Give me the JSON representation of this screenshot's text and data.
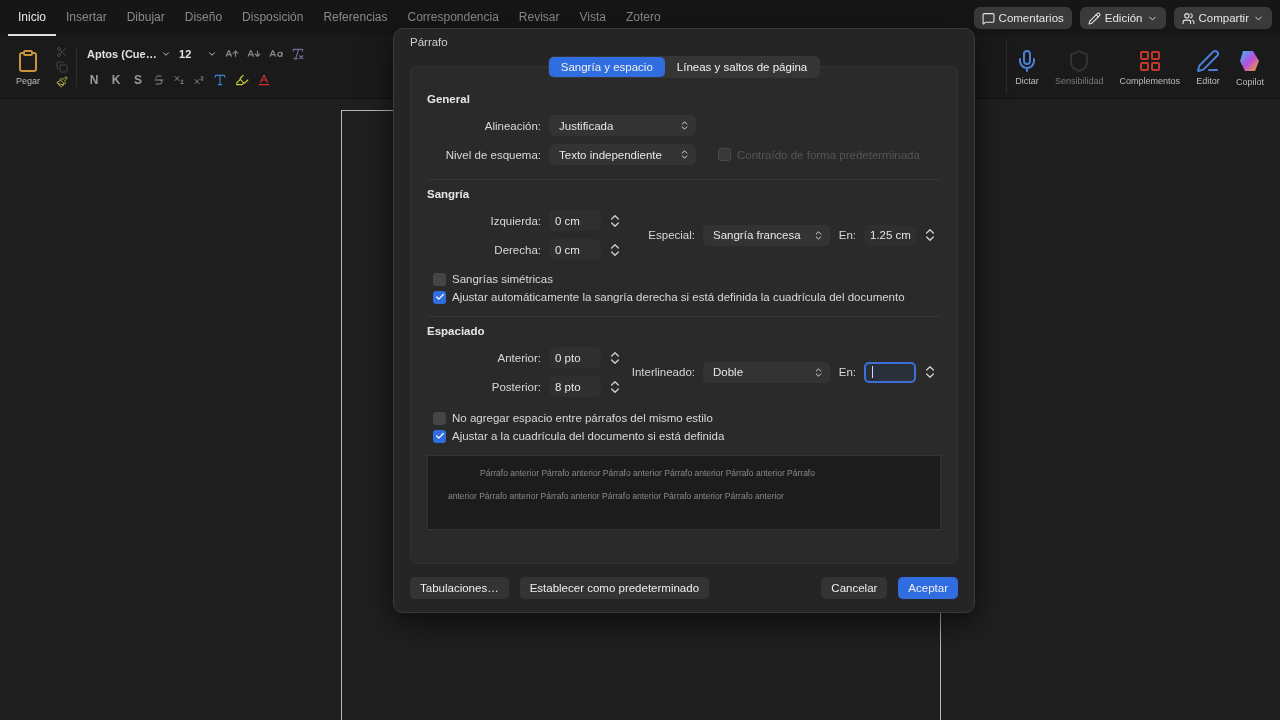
{
  "menu_tabs": [
    {
      "label": "Inicio",
      "selected": true
    },
    {
      "label": "Insertar",
      "selected": false
    },
    {
      "label": "Dibujar",
      "selected": false
    },
    {
      "label": "Diseño",
      "selected": false
    },
    {
      "label": "Disposición",
      "selected": false
    },
    {
      "label": "Referencias",
      "selected": false
    },
    {
      "label": "Correspondencia",
      "selected": false
    },
    {
      "label": "Revisar",
      "selected": false
    },
    {
      "label": "Vista",
      "selected": false
    },
    {
      "label": "Zotero",
      "selected": false
    }
  ],
  "header_buttons": [
    {
      "label": "Comentarios",
      "kind": "comment",
      "dropdown": false
    },
    {
      "label": "Edición",
      "kind": "edit",
      "dropdown": true
    },
    {
      "label": "Compartir",
      "kind": "share",
      "dropdown": true
    }
  ],
  "ribbon": {
    "paste_label": "Pegar",
    "font_name": "Aptos (Cue…",
    "font_size": "12",
    "format_buttons": [
      "N",
      "K",
      "S"
    ],
    "right_groups": [
      {
        "label": "Dictar",
        "kind": "mic",
        "disabled": false
      },
      {
        "label": "Sensibilidad",
        "kind": "sensitivity",
        "disabled": true
      },
      {
        "label": "Complementos",
        "kind": "addins",
        "disabled": false
      },
      {
        "label": "Editor",
        "kind": "editor",
        "disabled": false
      },
      {
        "label": "Copilot",
        "kind": "copilot",
        "disabled": false
      }
    ]
  },
  "dialog": {
    "title": "Párrafo",
    "tabs": [
      {
        "label": "Sangría y espacio",
        "selected": true
      },
      {
        "label": "Líneas y saltos de página",
        "selected": false
      }
    ],
    "general": {
      "title": "General",
      "alignment": {
        "label": "Alineación:",
        "value": "Justificada"
      },
      "outline": {
        "label": "Nivel de esquema:",
        "value": "Texto independiente"
      },
      "collapsed": {
        "label": "Contraído de forma predeterminada",
        "checked": false,
        "disabled": true
      }
    },
    "indent": {
      "title": "Sangría",
      "left": {
        "label": "Izquierda:",
        "value": "0 cm"
      },
      "right": {
        "label": "Derecha:",
        "value": "0 cm"
      },
      "special": {
        "label": "Especial:",
        "value": "Sangría francesa"
      },
      "by": {
        "label": "En:",
        "value": "1.25 cm",
        "focused": false
      },
      "checks": [
        {
          "label": "Sangrías simétricas",
          "checked": false
        },
        {
          "label": "Ajustar automáticamente la sangría derecha si está definida la cuadrícula del documento",
          "checked": true
        }
      ]
    },
    "spacing": {
      "title": "Espaciado",
      "before": {
        "label": "Anterior:",
        "value": "0 pto"
      },
      "after": {
        "label": "Posterior:",
        "value": "8 pto"
      },
      "line": {
        "label": "Interlineado:",
        "value": "Doble"
      },
      "at": {
        "label": "En:",
        "focused": true
      },
      "checks": [
        {
          "label": "No agregar espacio entre párrafos del mismo estilo",
          "checked": false
        },
        {
          "label": "Ajustar a la cuadrícula del documento si está definida",
          "checked": true
        }
      ]
    },
    "preview": {
      "lines": [
        "Párrafo anterior Párrafo anterior Párrafo anterior Párrafo anterior Párrafo anterior Párrafo",
        "anterior Párrafo anterior Párrafo anterior Párrafo anterior Párrafo anterior Párrafo anterior"
      ]
    },
    "buttons": [
      {
        "label": "Tabulaciones…",
        "kind": "secondary"
      },
      {
        "label": "Establecer como predeterminado",
        "kind": "secondary"
      },
      {
        "label": "Cancelar",
        "kind": "secondary"
      },
      {
        "label": "Aceptar",
        "kind": "primary"
      }
    ]
  }
}
